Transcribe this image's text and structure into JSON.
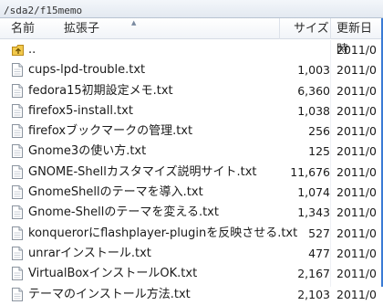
{
  "path": "/sda2/f15memo",
  "columns": {
    "name": "名前",
    "ext": "拡張子",
    "size": "サイズ",
    "date": "更新日時"
  },
  "files": [
    {
      "name": "..",
      "size": "",
      "date": "2011/0",
      "icon": "up-folder-icon"
    },
    {
      "name": "cups-lpd-trouble.txt",
      "size": "1,003",
      "date": "2011/0",
      "icon": "text-file-icon"
    },
    {
      "name": "fedora15初期設定メモ.txt",
      "size": "6,360",
      "date": "2011/0",
      "icon": "text-file-icon"
    },
    {
      "name": "firefox5-install.txt",
      "size": "1,038",
      "date": "2011/0",
      "icon": "text-file-icon"
    },
    {
      "name": "firefoxブックマークの管理.txt",
      "size": "256",
      "date": "2011/0",
      "icon": "text-file-icon"
    },
    {
      "name": "Gnome3の使い方.txt",
      "size": "125",
      "date": "2011/0",
      "icon": "text-file-icon"
    },
    {
      "name": "GNOME-Shellカスタマイズ説明サイト.txt",
      "size": "11,676",
      "date": "2011/0",
      "icon": "text-file-icon"
    },
    {
      "name": "GnomeShellのテーマを導入.txt",
      "size": "1,074",
      "date": "2011/0",
      "icon": "text-file-icon"
    },
    {
      "name": "Gnome-Shellのテーマを変える.txt",
      "size": "1,343",
      "date": "2011/0",
      "icon": "text-file-icon"
    },
    {
      "name": "konquerorにflashplayer-pluginを反映させる.txt",
      "size": "527",
      "date": "2011/0",
      "icon": "text-file-icon"
    },
    {
      "name": "unrarインストール.txt",
      "size": "477",
      "date": "2011/0",
      "icon": "text-file-icon"
    },
    {
      "name": "VirtualBoxインストールOK.txt",
      "size": "2,167",
      "date": "2011/0",
      "icon": "text-file-icon"
    },
    {
      "name": "テーマのインストール方法.txt",
      "size": "2,103",
      "date": "2011/0",
      "icon": "text-file-icon"
    }
  ]
}
